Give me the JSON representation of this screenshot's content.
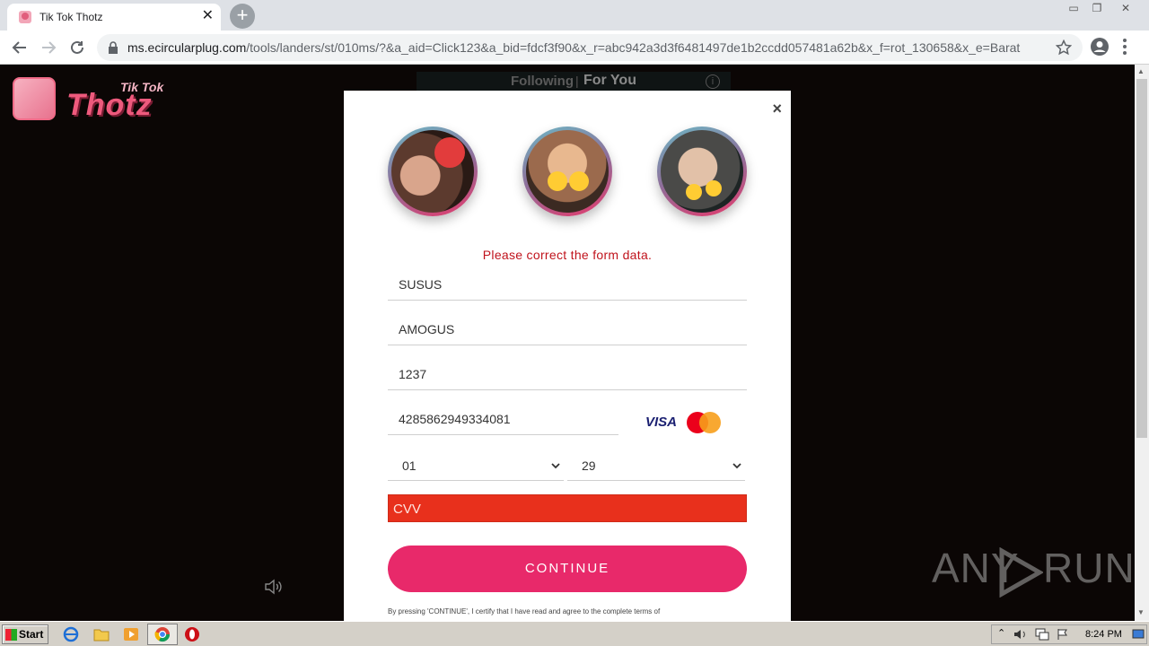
{
  "browser": {
    "tab_title": "Tik Tok Thotz",
    "url_host": "ms.ecircularplug.com",
    "url_path": "/tools/landers/st/010ms/?&a_aid=Click123&a_bid=fdcf3f90&x_r=abc942a3d3f6481497de1b2ccdd057481a62b&x_f=rot_130658&x_e=Barat"
  },
  "page": {
    "logo_small": "Tik Tok",
    "logo_big": "Thotz",
    "feed_following": "Following",
    "feed_separator": "|",
    "feed_foryou": "For You",
    "feed_info": "i"
  },
  "modal": {
    "close": "×",
    "error": "Please correct the form data.",
    "first_name": "SUSUS",
    "last_name": "AMOGUS",
    "zip": "1237",
    "card_number": "4285862949334081",
    "visa_label": "VISA",
    "exp_month": "01",
    "exp_year": "29",
    "cvv_placeholder": "CVV",
    "continue": "CONTINUE",
    "terms": "By pressing 'CONTINUE', I certify that I have read and agree to the complete terms of"
  },
  "watermark": {
    "left": "ANY",
    "right": "RUN"
  },
  "taskbar": {
    "start": "Start",
    "clock": "8:24 PM"
  },
  "colors": {
    "accent": "#e8296a",
    "error": "#c0131c",
    "cvv_bg": "#e8301c"
  }
}
